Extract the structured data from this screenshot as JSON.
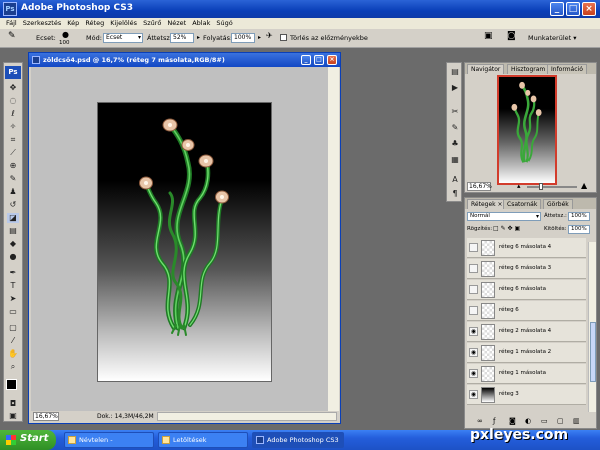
{
  "app": {
    "title": "Adobe Photoshop CS3",
    "badge": "Ps"
  },
  "window_buttons": {
    "minimize": "_",
    "maximize": "□",
    "close": "×"
  },
  "menu": [
    "Fájl",
    "Szerkesztés",
    "Kép",
    "Réteg",
    "Kijelölés",
    "Szűrő",
    "Nézet",
    "Ablak",
    "Súgó"
  ],
  "options": {
    "brush_label": "Ecset:",
    "brush_size": "100",
    "mode_label": "Mód:",
    "mode_value": "Ecset",
    "opacity_label": "Áttetsz.:",
    "opacity_value": "52%",
    "flow_label": "Folyatás:",
    "flow_value": "100%",
    "erase_history_label": "Törlés az előzményekbe",
    "workspace_label": "Munkaterület ▾"
  },
  "document": {
    "title": "zöldcső4.psd @ 16,7% (réteg 7 másolata,RGB/8#)",
    "zoom": "16,67%",
    "doc_info": "Dok.: 14,3M/46,2M"
  },
  "navigator": {
    "tabs": [
      "Navigátor",
      "Hisztogram",
      "Információ"
    ],
    "zoom": "16,67%"
  },
  "layers": {
    "tabs": [
      "Rétegek",
      "Csatornák",
      "Görbék"
    ],
    "blend_mode": "Normál",
    "opacity_label": "Áttetsz.:",
    "opacity_value": "100%",
    "lock_label": "Rögzítés:",
    "fill_label": "Kitöltés:",
    "fill_value": "100%",
    "items": [
      {
        "name": "réteg 6 másolata 4",
        "visible": false
      },
      {
        "name": "réteg 6 másolata 3",
        "visible": false
      },
      {
        "name": "réteg 6 másolata",
        "visible": false
      },
      {
        "name": "réteg 6",
        "visible": false
      },
      {
        "name": "réteg 2 másolata 4",
        "visible": true
      },
      {
        "name": "réteg 1 másolata 2",
        "visible": true
      },
      {
        "name": "réteg 1 másolata",
        "visible": true
      },
      {
        "name": "réteg 3",
        "visible": true
      }
    ]
  },
  "taskbar": {
    "start": "Start",
    "tasks": [
      "Névtelen - Jegyzettömb",
      "Letöltések",
      "Adobe Photoshop CS3"
    ]
  },
  "watermark": "pxleyes.com"
}
